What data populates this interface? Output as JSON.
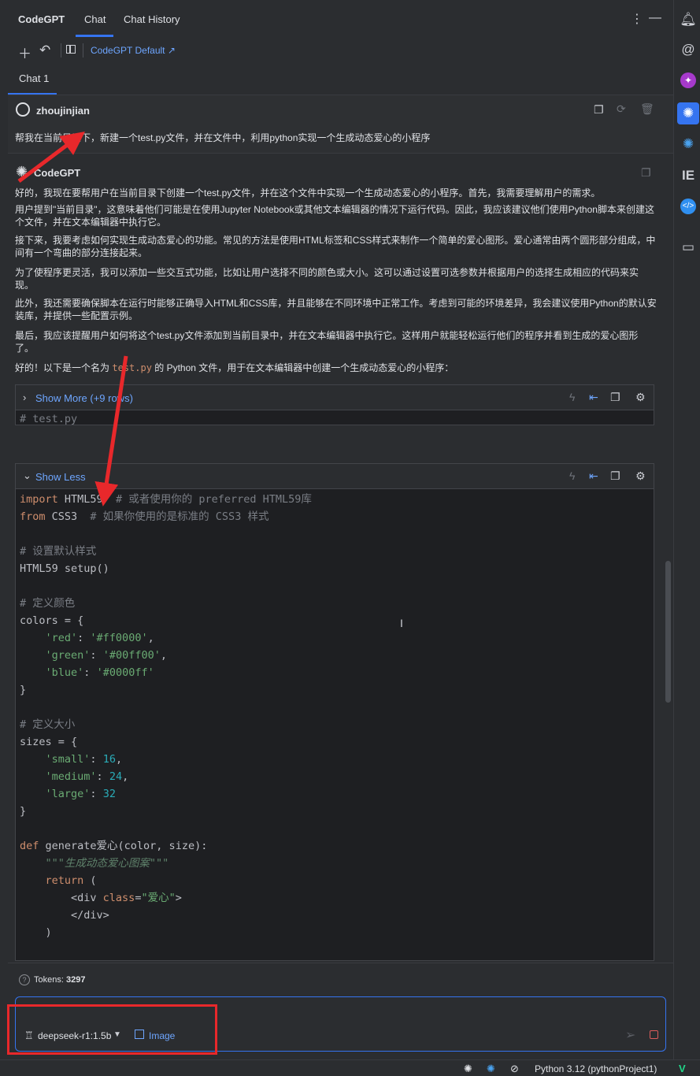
{
  "header": {
    "brand": "CodeGPT",
    "tabs": [
      "Chat",
      "Chat History"
    ],
    "more_icon": "⋮",
    "minimize_icon": "—"
  },
  "toolbar": {
    "model_link": "CodeGPT Default ↗"
  },
  "chat_tab": "Chat 1",
  "user_message": {
    "name": "zhoujinjian",
    "text": "帮我在当前目录下，新建一个test.py文件，并在文件中，利用python实现一个生成动态爱心的小程序"
  },
  "assistant": {
    "name": "CodeGPT",
    "paragraphs": [
      "好的，我现在要帮用户在当前目录下创建一个test.py文件，并在这个文件中实现一个生成动态爱心的小程序。首先，我需要理解用户的需求。",
      "用户提到\"当前目录\"，这意味着他们可能是在使用Jupyter Notebook或其他文本编辑器的情况下运行代码。因此，我应该建议他们使用Python脚本来创建这个文件，并在文本编辑器中执行它。",
      "接下来，我要考虑如何实现生成动态爱心的功能。常见的方法是使用HTML标签和CSS样式来制作一个简单的爱心图形。爱心通常由两个圆形部分组成，中间有一个弯曲的部分连接起来。",
      "为了使程序更灵活，我可以添加一些交互式功能，比如让用户选择不同的颜色或大小。这可以通过设置可选参数并根据用户的选择生成相应的代码来实现。",
      "此外，我还需要确保脚本在运行时能够正确导入HTML和CSS库，并且能够在不同环境中正常工作。考虑到可能的环境差异，我会建议使用Python的默认安装库，并提供一些配置示例。",
      "最后，我应该提醒用户如何将这个test.py文件添加到当前目录中，并在文本编辑器中执行它。这样用户就能轻松运行他们的程序并看到生成的爱心图形了。"
    ],
    "final_prefix": "好的！以下是一个名为 ",
    "final_code": "test.py",
    "final_suffix": " 的 Python 文件，用于在文本编辑器中创建一个生成动态爱心的小程序："
  },
  "code_block_1": {
    "toggle": "Show More (+9 rows)",
    "first_line": "# test.py"
  },
  "code_block_2": {
    "toggle": "Show Less"
  },
  "footer": {
    "tokens_label": "Tokens:",
    "tokens_value": "3297",
    "model": "deepseek-r1:1.5b",
    "image_label": "Image"
  },
  "statusbar": {
    "interpreter": "Python 3.12 (pythonProject1)"
  },
  "colors": {
    "accent": "#3574f0",
    "link": "#6ea6ff",
    "annotation_red": "#e8282b"
  }
}
